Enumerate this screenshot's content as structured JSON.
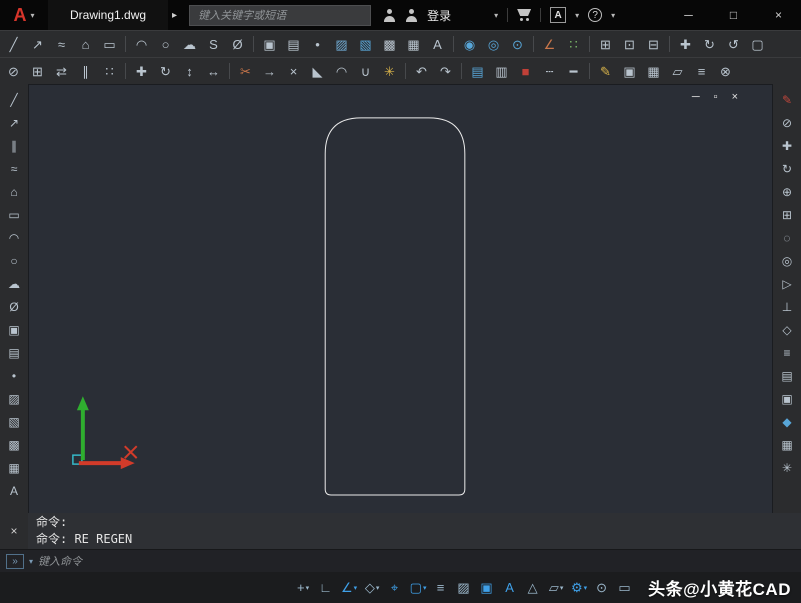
{
  "colors": {
    "canvas_bg": "#2a2e36",
    "shape_stroke": "#ebebeb",
    "axis_x_red": "#d23b2a",
    "axis_y_green": "#2fae2f",
    "origin_cyan": "#35b8c8",
    "accent_blue": "#3fa0e8"
  },
  "titlebar": {
    "logo_glyph": "A",
    "dropdown_caret": "▾",
    "doc_tab": "Drawing1.dwg",
    "tab_arrow": "▸",
    "search_placeholder": "键入关键字或短语",
    "signin_label": "登录",
    "signin_caret": "▾",
    "exchange_glyph": "A",
    "exchange_caret": "▾",
    "help_glyph": "?",
    "help_caret": "▾",
    "window_controls": {
      "minimize": "─",
      "maximize": "□",
      "close": "×"
    }
  },
  "toolbar_row1": [
    {
      "name": "line-icon",
      "glyph": "╱"
    },
    {
      "name": "construction-line-icon",
      "glyph": "↗"
    },
    {
      "name": "polyline-icon",
      "glyph": "≈"
    },
    {
      "name": "polygon-icon",
      "glyph": "⌂"
    },
    {
      "name": "rectangle-icon",
      "glyph": "▭"
    },
    {
      "sep": true
    },
    {
      "name": "arc-icon",
      "glyph": "◠"
    },
    {
      "name": "circle-icon",
      "glyph": "○"
    },
    {
      "name": "revision-cloud-icon",
      "glyph": "☁"
    },
    {
      "name": "spline-icon",
      "glyph": "S"
    },
    {
      "name": "ellipse-icon",
      "glyph": "Ø"
    },
    {
      "sep": true
    },
    {
      "name": "insert-block-icon",
      "glyph": "▣"
    },
    {
      "name": "create-block-icon",
      "glyph": "▤"
    },
    {
      "name": "point-icon",
      "glyph": "•"
    },
    {
      "name": "hatch-icon",
      "glyph": "▨",
      "color": "#6fa8d0"
    },
    {
      "name": "gradient-icon",
      "glyph": "▧",
      "color": "#58a6d8"
    },
    {
      "name": "region-icon",
      "glyph": "▩"
    },
    {
      "name": "table-icon",
      "glyph": "▦"
    },
    {
      "name": "multiline-text-icon",
      "glyph": "A"
    },
    {
      "sep": true
    },
    {
      "name": "donut-icon",
      "glyph": "◉",
      "color": "#58a6d8"
    },
    {
      "name": "circle-2p-icon",
      "glyph": "◎",
      "color": "#58a6d8"
    },
    {
      "name": "circle-3p-icon",
      "glyph": "⊙",
      "color": "#58a6d8"
    },
    {
      "sep": true
    },
    {
      "name": "measure-icon",
      "glyph": "∠",
      "color": "#c9764a"
    },
    {
      "name": "divide-icon",
      "glyph": "∷",
      "color": "#7dbb6a"
    },
    {
      "sep": true
    },
    {
      "name": "zoom-window-icon",
      "glyph": "⊞"
    },
    {
      "name": "zoom-extents-icon",
      "glyph": "⊡"
    },
    {
      "name": "zoom-previous-icon",
      "glyph": "⊟"
    },
    {
      "sep": true
    },
    {
      "name": "pan-icon",
      "glyph": "✚"
    },
    {
      "name": "orbit-icon",
      "glyph": "↻"
    },
    {
      "name": "regen-icon",
      "glyph": "↺"
    },
    {
      "name": "named-views-icon",
      "glyph": "▢"
    }
  ],
  "toolbar_row2": [
    {
      "name": "erase-icon",
      "glyph": "⊘"
    },
    {
      "name": "copy-icon",
      "glyph": "⊞"
    },
    {
      "name": "mirror-icon",
      "glyph": "⇄"
    },
    {
      "name": "offset-icon",
      "glyph": "∥"
    },
    {
      "name": "array-icon",
      "glyph": "∷"
    },
    {
      "sep": true
    },
    {
      "name": "move-icon",
      "glyph": "✚"
    },
    {
      "name": "rotate-icon",
      "glyph": "↻"
    },
    {
      "name": "scale-icon",
      "glyph": "↕"
    },
    {
      "name": "stretch-icon",
      "glyph": "↔"
    },
    {
      "sep": true
    },
    {
      "name": "trim-icon",
      "glyph": "✂",
      "color": "#c9764a"
    },
    {
      "name": "extend-icon",
      "glyph": "→"
    },
    {
      "name": "break-icon",
      "glyph": "×"
    },
    {
      "name": "chamfer-icon",
      "glyph": "◣"
    },
    {
      "name": "fillet-icon",
      "glyph": "◠"
    },
    {
      "name": "join-icon",
      "glyph": "∪"
    },
    {
      "name": "explode-icon",
      "glyph": "✳",
      "color": "#d8b34a"
    },
    {
      "sep": true
    },
    {
      "name": "undo-icon",
      "glyph": "↶"
    },
    {
      "name": "redo-icon",
      "glyph": "↷"
    },
    {
      "sep": true
    },
    {
      "name": "layer-icon",
      "glyph": "▤",
      "color": "#58a6d8"
    },
    {
      "name": "layer-properties-icon",
      "glyph": "▥"
    },
    {
      "name": "color-swatch-icon",
      "glyph": "■",
      "color": "#c04038"
    },
    {
      "name": "linetype-icon",
      "glyph": "┄"
    },
    {
      "name": "lineweight-icon",
      "glyph": "━"
    },
    {
      "sep": true
    },
    {
      "name": "match-properties-icon",
      "glyph": "✎",
      "color": "#d8b34a"
    },
    {
      "name": "group-icon",
      "glyph": "▣"
    },
    {
      "name": "quick-select-icon",
      "glyph": "▦"
    },
    {
      "name": "area-icon",
      "glyph": "▱"
    },
    {
      "name": "list-icon",
      "glyph": "≡"
    },
    {
      "name": "purge-icon",
      "glyph": "⊗"
    }
  ],
  "left_toolbar": [
    {
      "name": "line-icon",
      "glyph": "╱"
    },
    {
      "name": "construction-line-icon",
      "glyph": "↗"
    },
    {
      "name": "multiline-icon",
      "glyph": "∥"
    },
    {
      "name": "polyline-icon",
      "glyph": "≈"
    },
    {
      "name": "polygon-icon",
      "glyph": "⌂"
    },
    {
      "name": "rectangle-icon",
      "glyph": "▭"
    },
    {
      "name": "arc-icon",
      "glyph": "◠"
    },
    {
      "name": "circle-icon",
      "glyph": "○"
    },
    {
      "name": "revision-cloud-icon",
      "glyph": "☁"
    },
    {
      "name": "ellipse-icon",
      "glyph": "Ø"
    },
    {
      "name": "insert-block-icon",
      "glyph": "▣"
    },
    {
      "name": "create-block-icon",
      "glyph": "▤"
    },
    {
      "name": "point-icon",
      "glyph": "•"
    },
    {
      "name": "hatch-icon",
      "glyph": "▨"
    },
    {
      "name": "gradient-icon",
      "glyph": "▧"
    },
    {
      "name": "region-icon",
      "glyph": "▩"
    },
    {
      "name": "table-icon",
      "glyph": "▦"
    },
    {
      "name": "multiline-text-icon",
      "glyph": "A"
    }
  ],
  "right_toolbar": [
    {
      "name": "edit-pencil-icon",
      "glyph": "✎",
      "color": "#c0473c"
    },
    {
      "name": "erase-icon",
      "glyph": "⊘"
    },
    {
      "name": "move-icon",
      "glyph": "✚"
    },
    {
      "name": "rotate-icon",
      "glyph": "↻"
    },
    {
      "name": "zoom-realtime-icon",
      "glyph": "⊕"
    },
    {
      "name": "zoom-window-icon",
      "glyph": "⊞"
    },
    {
      "name": "orbit-icon",
      "glyph": "◌"
    },
    {
      "name": "steering-wheel-icon",
      "glyph": "◎"
    },
    {
      "name": "show-motion-icon",
      "glyph": "▷"
    },
    {
      "name": "ucs-icon",
      "glyph": "⊥"
    },
    {
      "name": "view-cube-icon",
      "glyph": "◇"
    },
    {
      "name": "navigation-bar-icon",
      "glyph": "≡"
    },
    {
      "name": "layer-walk-icon",
      "glyph": "▤"
    },
    {
      "name": "xref-icon",
      "glyph": "▣"
    },
    {
      "name": "render-icon",
      "glyph": "◆",
      "color": "#58a6d8"
    },
    {
      "name": "materials-icon",
      "glyph": "▦"
    },
    {
      "name": "lights-icon",
      "glyph": "✳"
    }
  ],
  "canvas": {
    "doc_controls": {
      "minimize": "─",
      "restore": "▫",
      "close": "×"
    }
  },
  "command": {
    "close_glyph": "×",
    "lines": [
      "命令:",
      "命令: RE REGEN"
    ],
    "prompt_glyph": "»",
    "prompt_caret": "▾",
    "input_placeholder": "键入命令"
  },
  "statusbar": {
    "icons": [
      {
        "name": "snap-mode-icon",
        "glyph": "+",
        "caret": "▾"
      },
      {
        "name": "ortho-mode-icon",
        "glyph": "∟"
      },
      {
        "name": "polar-tracking-icon",
        "glyph": "∠",
        "caret": "▾",
        "color": "#3fa0e8"
      },
      {
        "name": "isometric-drafting-icon",
        "glyph": "◇",
        "caret": "▾"
      },
      {
        "name": "object-snap-tracking-icon",
        "glyph": "⌖",
        "color": "#3fa0e8"
      },
      {
        "name": "object-snap-icon",
        "glyph": "▢",
        "caret": "▾",
        "color": "#3fa0e8"
      },
      {
        "name": "lineweight-icon",
        "glyph": "≡"
      },
      {
        "name": "transparency-icon",
        "glyph": "▨"
      },
      {
        "name": "selection-cycling-icon",
        "glyph": "▣",
        "color": "#3fa0e8"
      },
      {
        "name": "annotation-visibility-icon",
        "glyph": "A",
        "color": "#3fa0e8"
      },
      {
        "name": "annotation-autoscale-icon",
        "glyph": "△"
      },
      {
        "name": "annotation-scale-icon",
        "glyph": "▱",
        "caret": "▾"
      },
      {
        "name": "workspace-switching-icon",
        "glyph": "⚙",
        "caret": "▾",
        "color": "#3fa0e8"
      },
      {
        "name": "annotation-monitor-icon",
        "glyph": "⊙"
      },
      {
        "name": "clean-screen-icon",
        "glyph": "▭"
      }
    ],
    "watermark": "头条@小黄花CAD"
  }
}
